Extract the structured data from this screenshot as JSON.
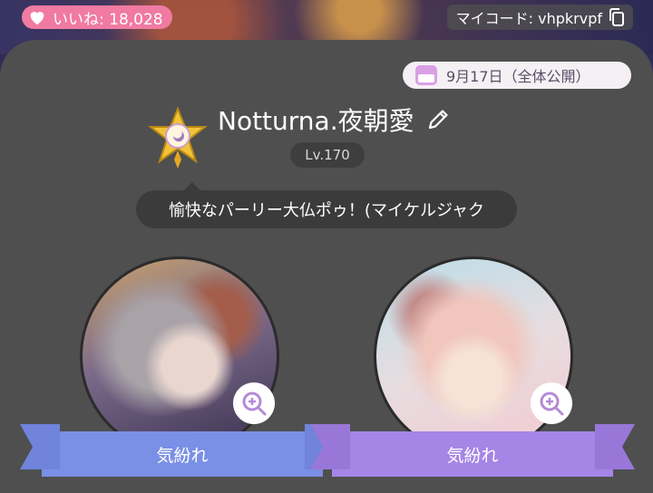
{
  "header": {
    "likes_text": "いいね: 18,028",
    "mycode_text": "マイコード: vhpkrvpf"
  },
  "profile": {
    "date_text": "9月17日（全体公開）",
    "name": "Notturna.夜朝愛",
    "level": "Lv.170",
    "status_message": "愉快なパーリー大仏ポゥ！(マイケルジャク"
  },
  "cards": [
    {
      "label": "気紛れ"
    },
    {
      "label": "気紛れ"
    }
  ],
  "colors": {
    "likes_pill": "#f07aa2",
    "panel": "#4f4f4f",
    "ribbon_left": "#7a8fe6",
    "ribbon_right": "#a585e6",
    "zoom_icon": "#b48ad8"
  }
}
